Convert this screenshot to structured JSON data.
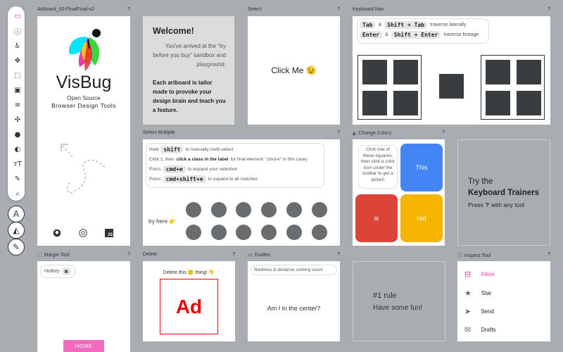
{
  "toolbar": {
    "icons": [
      "guides-icon",
      "inspect-icon",
      "accessibility-icon",
      "move-icon",
      "margin-icon",
      "padding-icon",
      "align-icon",
      "hueshift-icon",
      "boxshadow-icon",
      "position-icon",
      "font-icon",
      "text-icon",
      "search-icon"
    ],
    "round_buttons": [
      "A",
      "",
      ""
    ]
  },
  "boards": {
    "visbug": {
      "label": "Artboard_00-FinalFinal-v2",
      "q": "?",
      "title": "VisBug",
      "sub1": "Open Source",
      "sub2": "Browser Design Tools",
      "badge": "JS"
    },
    "welcome": {
      "heading": "Welcome!",
      "p1": "You've arrived at the \"try before you buy\" sandbox and playground.",
      "p2": "Each artboard is tailor made to provoke your design brain and teach you a feature."
    },
    "select": {
      "label": "Select",
      "q": "?",
      "text": "Click Me 😉"
    },
    "keynav": {
      "label": "Keyboard Nav",
      "q": "?",
      "k1": "Tab",
      "amp1": "&",
      "k2": "Shift + Tab",
      "t1": "traverse laterally",
      "k3": "Enter",
      "amp2": "&",
      "k4": "Shift + Enter",
      "t2": "traverse lineage"
    },
    "multi": {
      "label": "Select Multiple",
      "q": "?",
      "l1a": "Hold",
      "l1k": "shift",
      "l1b": "to manually multi-select",
      "l2a": "Click 1, then",
      "l2b": "click a class in the label",
      "l2c": "for final element: \"cmd-e\" in this case)",
      "l3a": "Press",
      "l3k": "cmd+e",
      "l3b": "to expand your selection",
      "l4a": "Press",
      "l4k": "cmd+shift+e",
      "l4b": "to expand to all matches",
      "try": "try here 👉"
    },
    "colors": {
      "label": "Change Colors",
      "q": "?",
      "instr": "Click one of these squares, then click a color icon under the toolbar to get a picker!",
      "this": "This",
      "is": "is",
      "rad": "rad",
      "c_blue": "#4285f4",
      "c_red": "#db4437",
      "c_yellow": "#f4b400"
    },
    "trainers": {
      "line1": "Try the",
      "line2": "Keyboard Trainers",
      "line3a": "Press",
      "line3k": "?",
      "line3b": "with any tool"
    },
    "margin": {
      "label": "Margin Tool",
      "q": "?",
      "hotkey": "Hotkey",
      "key": "m",
      "button": "HOME"
    },
    "delete": {
      "label": "Delete",
      "q": "?",
      "text": "Delete this 🤫 thing! 👇",
      "ad": "Ad"
    },
    "guides": {
      "label": "Guides",
      "q": "?",
      "note": "Redlines & distance coming soon!",
      "center": "Am I in the center?"
    },
    "rule": {
      "title": "#1 rule",
      "sub": "Have some fun!"
    },
    "inspect": {
      "label": "Inspect Tool",
      "q": "?",
      "items": [
        "Inbox",
        "Star",
        "Send",
        "Drafts"
      ],
      "accent": "#e93aa5"
    }
  }
}
